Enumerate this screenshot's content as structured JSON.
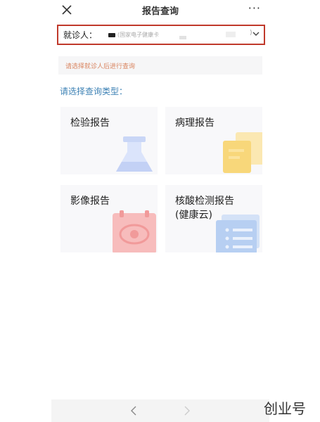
{
  "header": {
    "title": "报告查询",
    "more": "···"
  },
  "patient": {
    "label": "就诊人：",
    "value": "(国家电子健康卡",
    "closing": ")"
  },
  "hint": "请选择就诊人后进行查询",
  "section_label": "请选择查询类型：",
  "cards": [
    {
      "label": "检验报告",
      "icon": "flask-icon",
      "color": "#c9d6f6"
    },
    {
      "label": "病理报告",
      "icon": "document-stack-icon",
      "color": "#f8d77a"
    },
    {
      "label": "影像报告",
      "icon": "imaging-report-icon",
      "color": "#f4a9a9"
    },
    {
      "label": "核酸检测报告\n(健康云)",
      "icon": "list-document-icon",
      "color": "#b7cff2"
    }
  ],
  "watermark": "创业号",
  "colors": {
    "highlight_border": "#c0392b",
    "hint_text": "#d9845f",
    "section_text": "#3e82b5"
  }
}
